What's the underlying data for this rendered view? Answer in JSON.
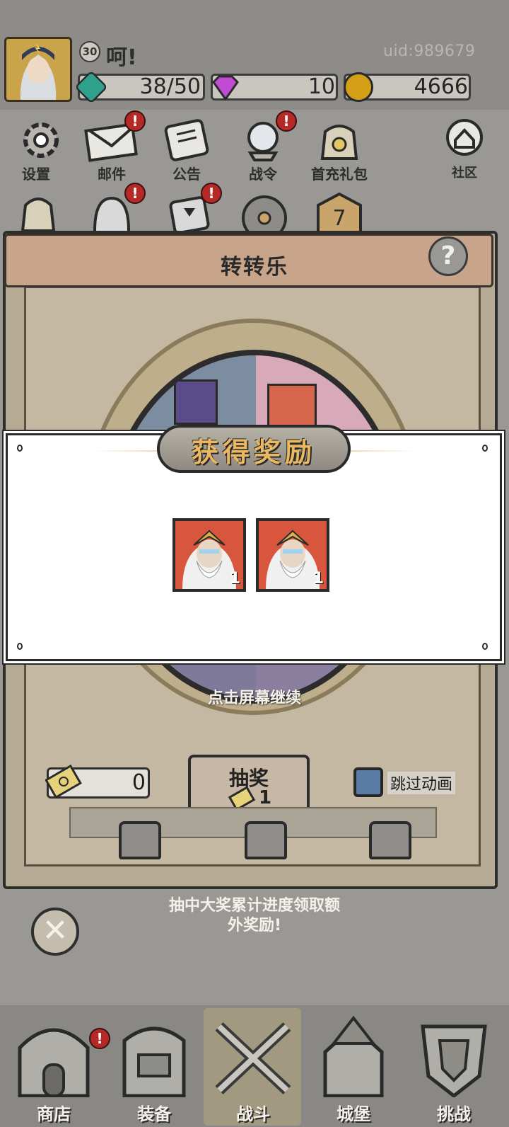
{
  "player": {
    "level": "30",
    "name": "呵!",
    "uid": "uid:989679"
  },
  "resources": [
    {
      "icon": "green-gem-icon",
      "value": "38/50",
      "color": "#2fa08c"
    },
    {
      "icon": "purple-diamond-icon",
      "value": "10",
      "color": "#c24bd6"
    },
    {
      "icon": "gold-coin-icon",
      "value": "4666",
      "color": "#d4a017"
    }
  ],
  "menu": {
    "settings": "设置",
    "mail": "邮件",
    "notice": "公告",
    "battle_pass": "战令",
    "first_recharge": "首充礼包",
    "community": "社区"
  },
  "panel": {
    "title": "转转乐",
    "help": "?"
  },
  "popup": {
    "title": "获得奖励",
    "rewards": [
      {
        "icon": "hero-portrait-icon",
        "count": "1"
      },
      {
        "icon": "hero-portrait-icon",
        "count": "1"
      }
    ],
    "continue_hint": "点击屏幕继续"
  },
  "controls": {
    "ticket_count": "0",
    "draw_label": "抽奖",
    "draw_cost": "1",
    "skip_label": "跳过动画",
    "bonus_text_line1": "抽中大奖累计进度领取额",
    "bonus_text_line2": "外奖励!"
  },
  "nav": {
    "shop": "商店",
    "equipment": "装备",
    "battle": "战斗",
    "castle": "城堡",
    "challenge": "挑战"
  },
  "colors": {
    "notify": "#b52a26",
    "popup_title": "#e9b860",
    "skip_checkbox": "#5a7ba3"
  }
}
